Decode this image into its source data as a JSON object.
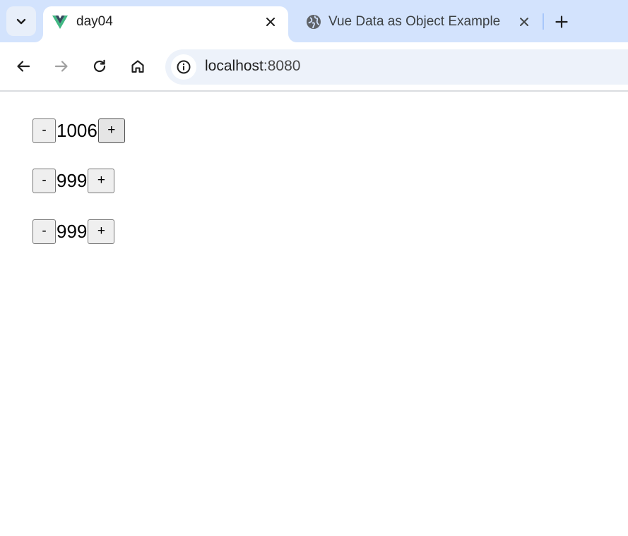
{
  "browser": {
    "tabs": [
      {
        "title": "day04",
        "favicon": "vue-logo-icon",
        "active": true
      },
      {
        "title": "Vue Data as Object Example",
        "favicon": "globe-icon",
        "active": false
      }
    ],
    "address_bar": {
      "host": "localhost",
      "port": ":8080"
    },
    "colors": {
      "tabstrip": "#d3e3fd",
      "omnibox": "#edf2fa",
      "vue_green": "#41b883",
      "vue_dark": "#35495e"
    }
  },
  "counters": [
    {
      "minus_label": "-",
      "value": "1006",
      "plus_label": "+"
    },
    {
      "minus_label": "-",
      "value": "999",
      "plus_label": "+"
    },
    {
      "minus_label": "-",
      "value": "999",
      "plus_label": "+"
    }
  ]
}
